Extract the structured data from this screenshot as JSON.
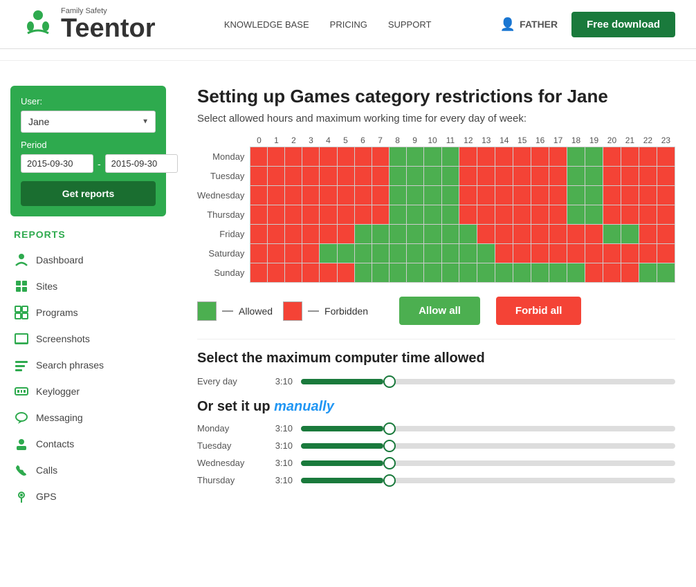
{
  "header": {
    "logo_text": "Teentor",
    "logo_family": "Family Safety",
    "nav": [
      {
        "label": "KNOWLEDGE BASE",
        "href": "#"
      },
      {
        "label": "PRICING",
        "href": "#"
      },
      {
        "label": "SUPPORT",
        "href": "#"
      }
    ],
    "user": "FATHER",
    "free_download": "Free download"
  },
  "sidebar": {
    "user_label": "User:",
    "user_value": "Jane",
    "period_label": "Period",
    "date_from": "2015-09-30",
    "date_to": "2015-09-30",
    "get_reports": "Get reports",
    "reports_title": "REPORTS",
    "nav_items": [
      {
        "label": "Dashboard",
        "icon": "⬡"
      },
      {
        "label": "Sites",
        "icon": "▦"
      },
      {
        "label": "Programs",
        "icon": "⊞"
      },
      {
        "label": "Screenshots",
        "icon": "🖥"
      },
      {
        "label": "Search phrases",
        "icon": "🔍"
      },
      {
        "label": "Keylogger",
        "icon": "⌨"
      },
      {
        "label": "Messaging",
        "icon": "💬"
      },
      {
        "label": "Contacts",
        "icon": "👤"
      },
      {
        "label": "Calls",
        "icon": "📞"
      },
      {
        "label": "GPS",
        "icon": "📍"
      }
    ]
  },
  "content": {
    "title": "Setting up Games category restrictions for Jane",
    "subtitle": "Select allowed hours and maximum working time for every day of week:",
    "hours": [
      0,
      1,
      2,
      3,
      4,
      5,
      6,
      7,
      8,
      9,
      10,
      11,
      12,
      13,
      14,
      15,
      16,
      17,
      18,
      19,
      20,
      21,
      22,
      23
    ],
    "days": [
      "Monday",
      "Tuesday",
      "Wednesday",
      "Thursday",
      "Friday",
      "Saturday",
      "Sunday"
    ],
    "grid": [
      [
        1,
        1,
        1,
        1,
        1,
        1,
        1,
        1,
        0,
        0,
        0,
        0,
        1,
        1,
        1,
        1,
        1,
        1,
        0,
        0,
        1,
        1,
        1,
        1
      ],
      [
        1,
        1,
        1,
        1,
        1,
        1,
        1,
        1,
        0,
        0,
        0,
        0,
        1,
        1,
        1,
        1,
        1,
        1,
        0,
        0,
        1,
        1,
        1,
        1
      ],
      [
        1,
        1,
        1,
        1,
        1,
        1,
        1,
        1,
        0,
        0,
        0,
        0,
        1,
        1,
        1,
        1,
        1,
        1,
        0,
        0,
        1,
        1,
        1,
        1
      ],
      [
        1,
        1,
        1,
        1,
        1,
        1,
        1,
        1,
        0,
        0,
        0,
        0,
        1,
        1,
        1,
        1,
        1,
        1,
        0,
        0,
        1,
        1,
        1,
        1
      ],
      [
        1,
        1,
        1,
        1,
        1,
        1,
        0,
        0,
        0,
        0,
        0,
        0,
        0,
        1,
        1,
        1,
        1,
        1,
        1,
        1,
        0,
        0,
        1,
        1
      ],
      [
        1,
        1,
        1,
        1,
        0,
        0,
        0,
        0,
        0,
        0,
        0,
        0,
        0,
        0,
        1,
        1,
        1,
        1,
        1,
        1,
        1,
        1,
        1,
        1
      ],
      [
        1,
        1,
        1,
        1,
        1,
        1,
        0,
        0,
        0,
        0,
        0,
        0,
        0,
        0,
        0,
        0,
        0,
        0,
        0,
        1,
        1,
        1,
        0,
        0
      ]
    ],
    "legend": {
      "allowed_label": "Allowed",
      "forbidden_label": "Forbidden",
      "allow_all": "Allow all",
      "forbid_all": "Forbid all"
    },
    "max_time_title": "Select the maximum computer time allowed",
    "everyday_label": "Every day",
    "everyday_value": "3:10",
    "everyday_pct": 22,
    "manual_title": "Or set it up manually",
    "manual_rows": [
      {
        "day": "Monday",
        "value": "3:10",
        "pct": 22
      },
      {
        "day": "Tuesday",
        "value": "3:10",
        "pct": 22
      },
      {
        "day": "Wednesday",
        "value": "3:10",
        "pct": 22
      },
      {
        "day": "Thursday",
        "value": "3:10",
        "pct": 22
      }
    ]
  }
}
